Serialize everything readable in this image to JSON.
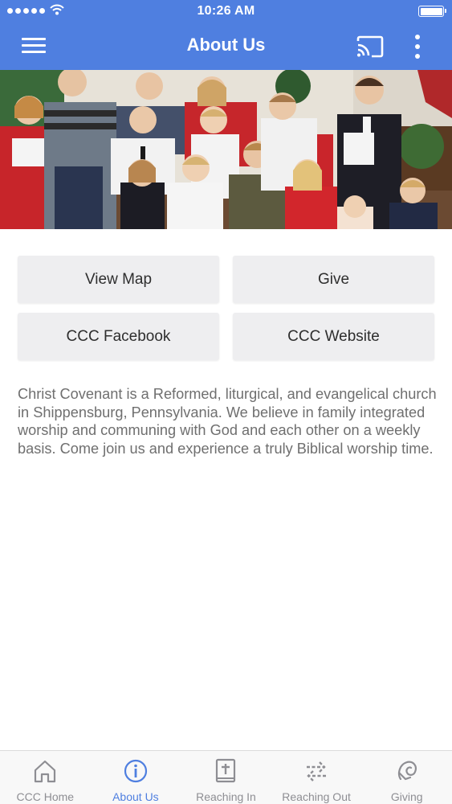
{
  "status_bar": {
    "time": "10:26 AM"
  },
  "header": {
    "title": "About Us"
  },
  "colors": {
    "brand": "#4f7fe0",
    "button_bg": "#eeeef0",
    "body_text": "#6f6f6f",
    "tab_inactive": "#8e8e93"
  },
  "icons": {
    "menu": "hamburger-menu-icon",
    "cast": "cast-icon",
    "more": "more-vertical-icon"
  },
  "actions": {
    "view_map": "View Map",
    "give": "Give",
    "facebook": "CCC Facebook",
    "website": "CCC Website"
  },
  "description": "Christ Covenant is a Reformed, liturgical, and evangelical church in Shippensburg, Pennsylvania. We believe in family integrated worship and communing with God and each other on a weekly basis. Come join us and experience a truly Biblical worship time.",
  "tabs": [
    {
      "label": "CCC Home",
      "icon": "home-icon",
      "active": false
    },
    {
      "label": "About Us",
      "icon": "info-icon",
      "active": true
    },
    {
      "label": "Reaching In",
      "icon": "bible-icon",
      "active": false
    },
    {
      "label": "Reaching Out",
      "icon": "swap-arrows-icon",
      "active": false
    },
    {
      "label": "Giving",
      "icon": "giving-hand-icon",
      "active": false
    }
  ]
}
